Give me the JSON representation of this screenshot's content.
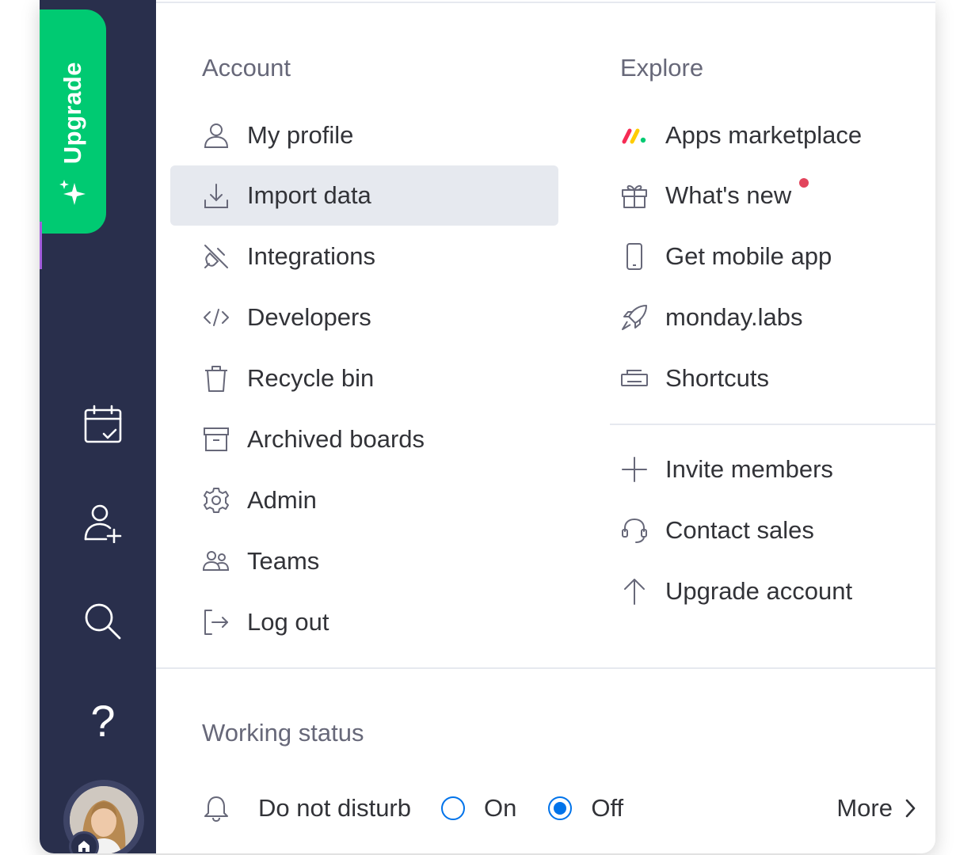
{
  "sidebar": {
    "upgrade_label": "Upgrade",
    "icons": [
      "calendar-check-icon",
      "add-user-icon",
      "search-icon",
      "help-icon"
    ],
    "help_glyph": "?"
  },
  "account": {
    "title": "Account",
    "items": [
      {
        "label": "My profile",
        "icon": "user-icon"
      },
      {
        "label": "Import data",
        "icon": "download-icon"
      },
      {
        "label": "Integrations",
        "icon": "plug-icon"
      },
      {
        "label": "Developers",
        "icon": "code-icon"
      },
      {
        "label": "Recycle bin",
        "icon": "trash-icon"
      },
      {
        "label": "Archived boards",
        "icon": "archive-icon"
      },
      {
        "label": "Admin",
        "icon": "gear-icon"
      },
      {
        "label": "Teams",
        "icon": "team-icon"
      },
      {
        "label": "Log out",
        "icon": "logout-icon"
      }
    ]
  },
  "explore": {
    "title": "Explore",
    "items": [
      {
        "label": "Apps marketplace",
        "icon": "monday-logo-icon"
      },
      {
        "label": "What's new",
        "icon": "gift-icon"
      },
      {
        "label": "Get mobile app",
        "icon": "mobile-icon"
      },
      {
        "label": "monday.labs",
        "icon": "rocket-icon"
      },
      {
        "label": "Shortcuts",
        "icon": "keyboard-icon"
      }
    ],
    "actions": [
      {
        "label": "Invite members",
        "icon": "plus-icon"
      },
      {
        "label": "Contact sales",
        "icon": "headset-icon"
      },
      {
        "label": "Upgrade account",
        "icon": "arrow-up-icon"
      }
    ]
  },
  "working_status": {
    "title": "Working status",
    "dnd_label": "Do not disturb",
    "on_label": "On",
    "off_label": "Off",
    "selected": "Off",
    "more_label": "More"
  },
  "colors": {
    "sidebar": "#292f4c",
    "upgrade": "#00ca72",
    "accent": "#0073ea",
    "notification": "#e2445c",
    "active_bg": "#e6e9ef"
  }
}
